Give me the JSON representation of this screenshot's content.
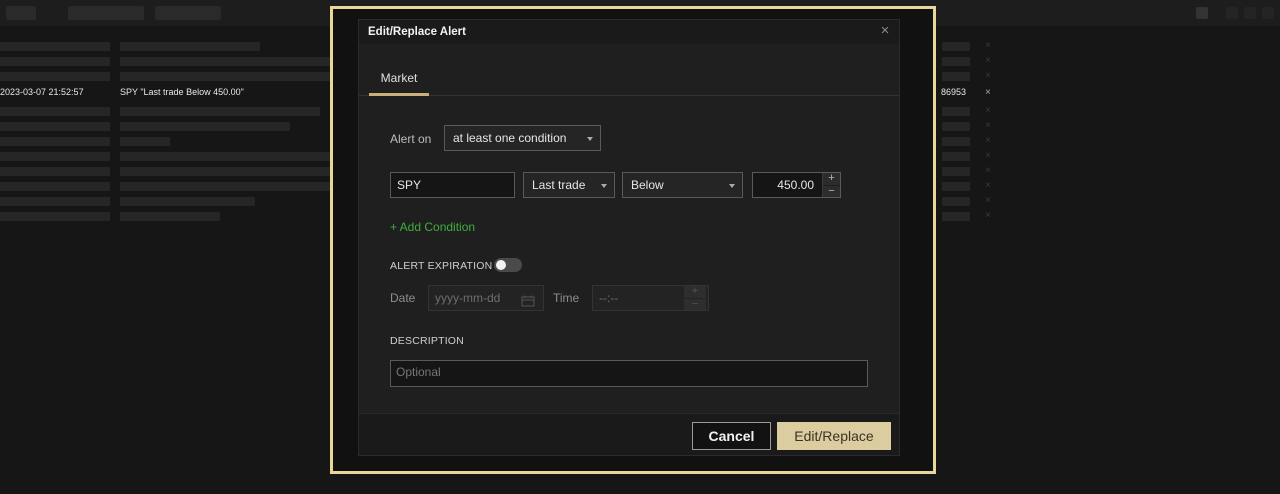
{
  "background": {
    "active_row": {
      "timestamp": "2023-03-07 21:52:57",
      "description": "SPY \"Last trade Below 450.00\"",
      "id": "86953",
      "remove_glyph": "×"
    },
    "remove_glyph": "×"
  },
  "dialog": {
    "title": "Edit/Replace Alert",
    "close_glyph": "×",
    "tabs": [
      {
        "label": "Market",
        "selected": true
      }
    ],
    "alert_on": {
      "label": "Alert on",
      "value": "at least one condition"
    },
    "condition": {
      "symbol": "SPY",
      "field": "Last trade",
      "operator": "Below",
      "value": "450.00",
      "increment_glyph": "+",
      "decrement_glyph": "−"
    },
    "add_condition_label": "+ Add Condition",
    "expiration": {
      "label": "ALERT EXPIRATION",
      "enabled": false,
      "date_label": "Date",
      "date_placeholder": "yyyy-mm-dd",
      "time_label": "Time",
      "time_placeholder": "--:--",
      "calendar_icon": "calendar-icon"
    },
    "description": {
      "label": "DESCRIPTION",
      "placeholder": "Optional"
    },
    "buttons": {
      "cancel": "Cancel",
      "submit": "Edit/Replace"
    }
  },
  "colors": {
    "highlight_frame": "#e9d79a",
    "primary_button": "#dccda0",
    "add_condition": "#3fae3f",
    "tab_underline": "#c8b27a"
  }
}
